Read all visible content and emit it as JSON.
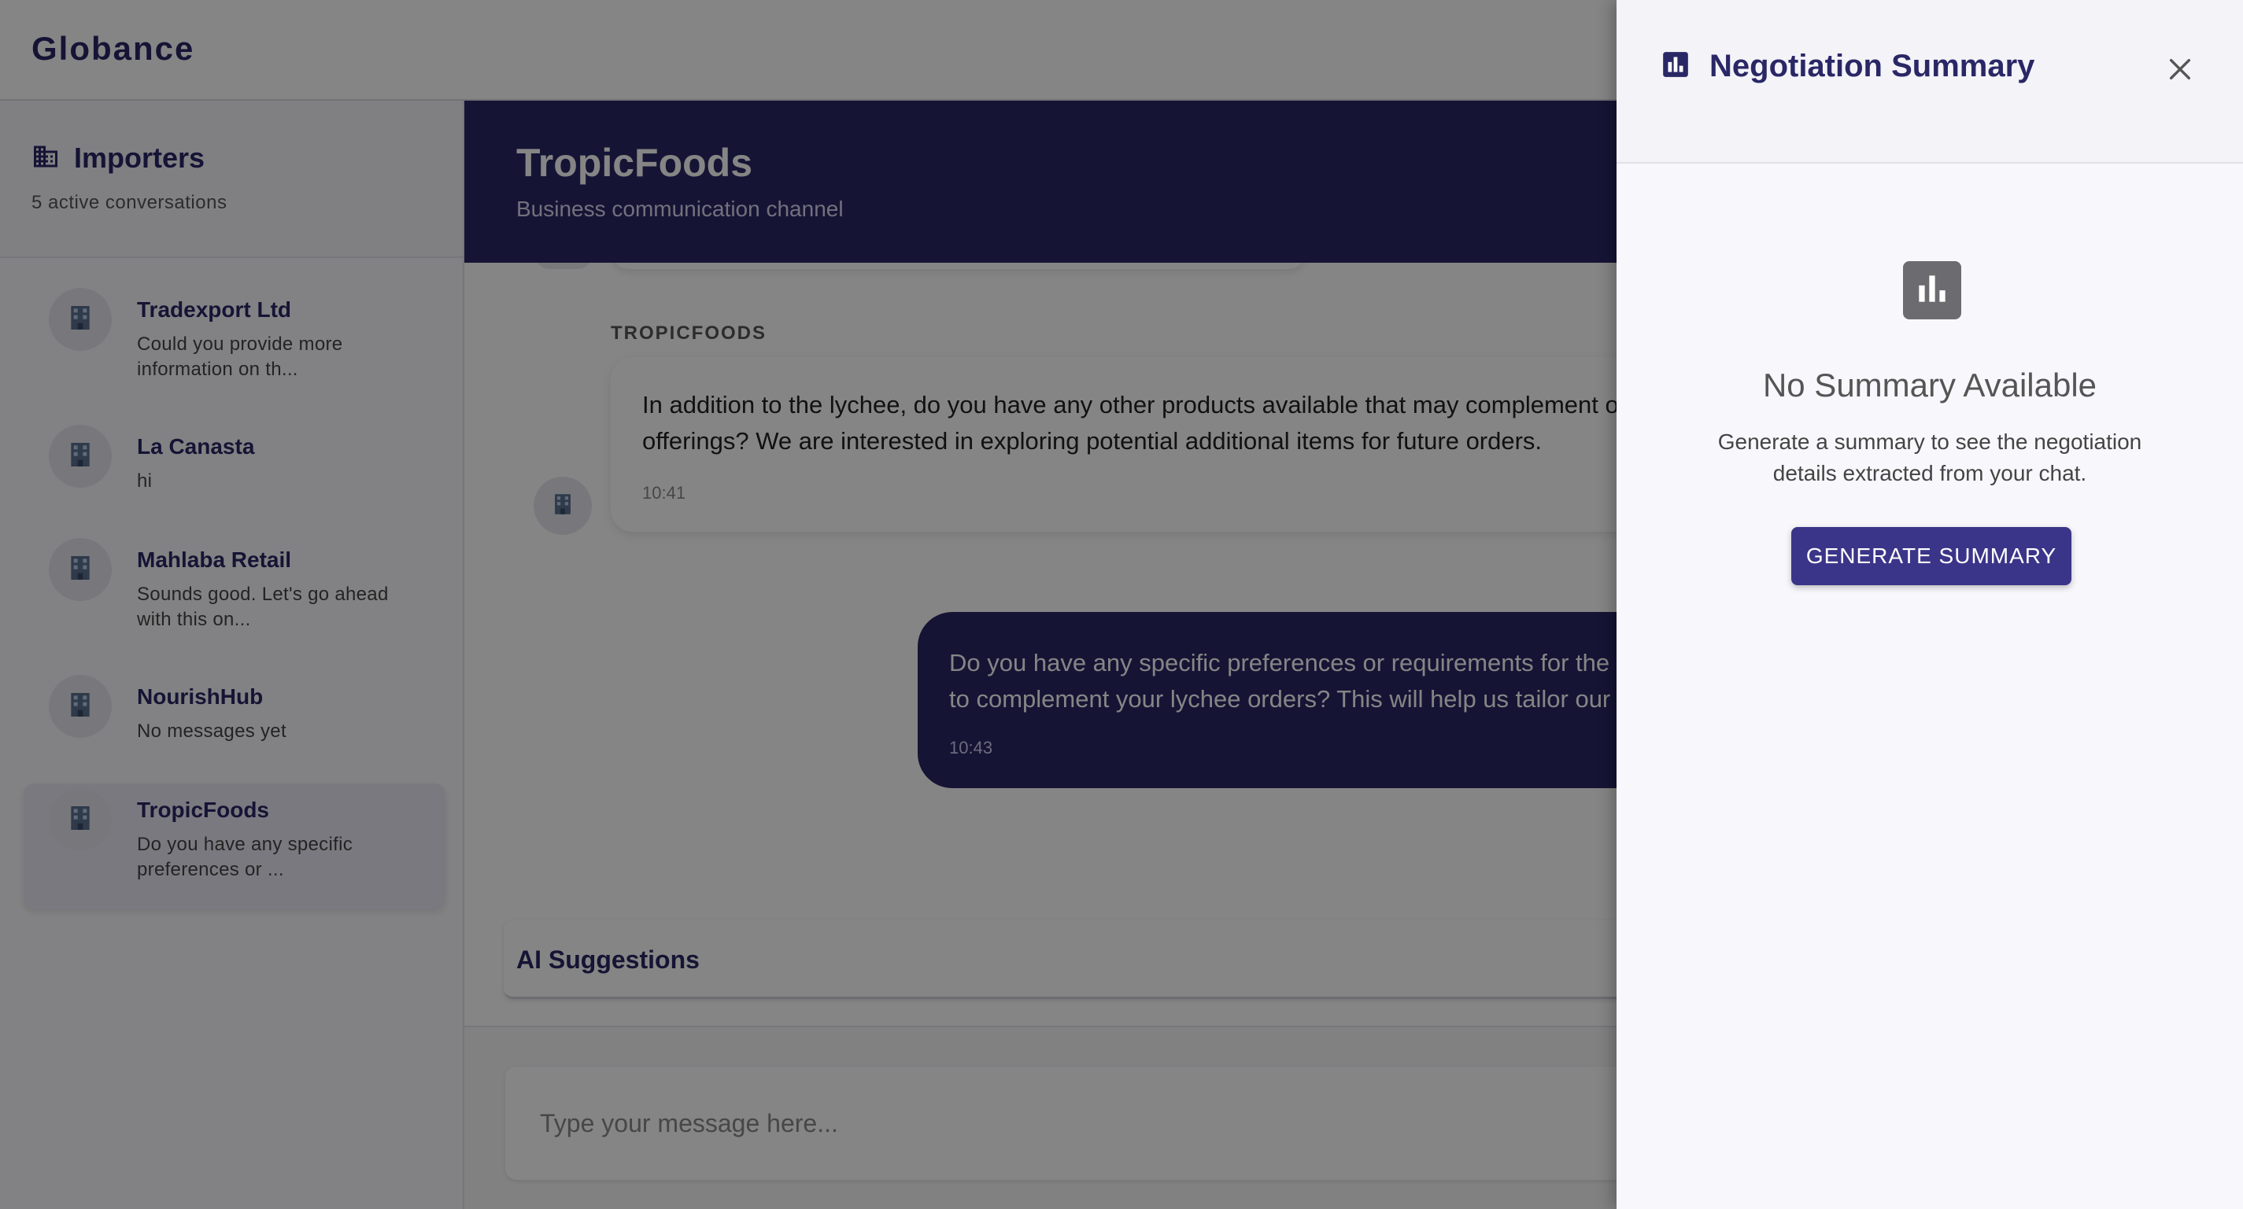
{
  "app": {
    "brand": "Globance"
  },
  "sidebar": {
    "title": "Importers",
    "subtitle": "5 active conversations",
    "conversations": [
      {
        "name": "Tradexport Ltd",
        "preview": "Could you provide more information on th..."
      },
      {
        "name": "La Canasta",
        "preview": "hi"
      },
      {
        "name": "Mahlaba Retail",
        "preview": "Sounds good. Let's go ahead with this on..."
      },
      {
        "name": "NourishHub",
        "preview": "No messages yet"
      },
      {
        "name": "TropicFoods",
        "preview": "Do you have any specific preferences or ..."
      }
    ]
  },
  "chat": {
    "title": "TropicFoods",
    "subtitle": "Business communication channel",
    "messages": [
      {
        "sender": "TROPICFOODS",
        "line1": "In addition to the lychee, do you have any other products available that may complement o",
        "line2": "offerings? We are interested in exploring potential additional items for future orders.",
        "time": "10:41"
      },
      {
        "line1": "Do you have any specific preferences or requirements for the a",
        "line2": "to complement your lychee orders? This will help us tailor our",
        "time": "10:43"
      }
    ],
    "ai_suggestions_label": "AI Suggestions",
    "input_placeholder": "Type your message here..."
  },
  "drawer": {
    "title": "Negotiation Summary",
    "empty_title": "No Summary Available",
    "empty_desc": "Generate a summary to see the negotiation details extracted from your chat.",
    "generate_button": "GENERATE SUMMARY"
  }
}
